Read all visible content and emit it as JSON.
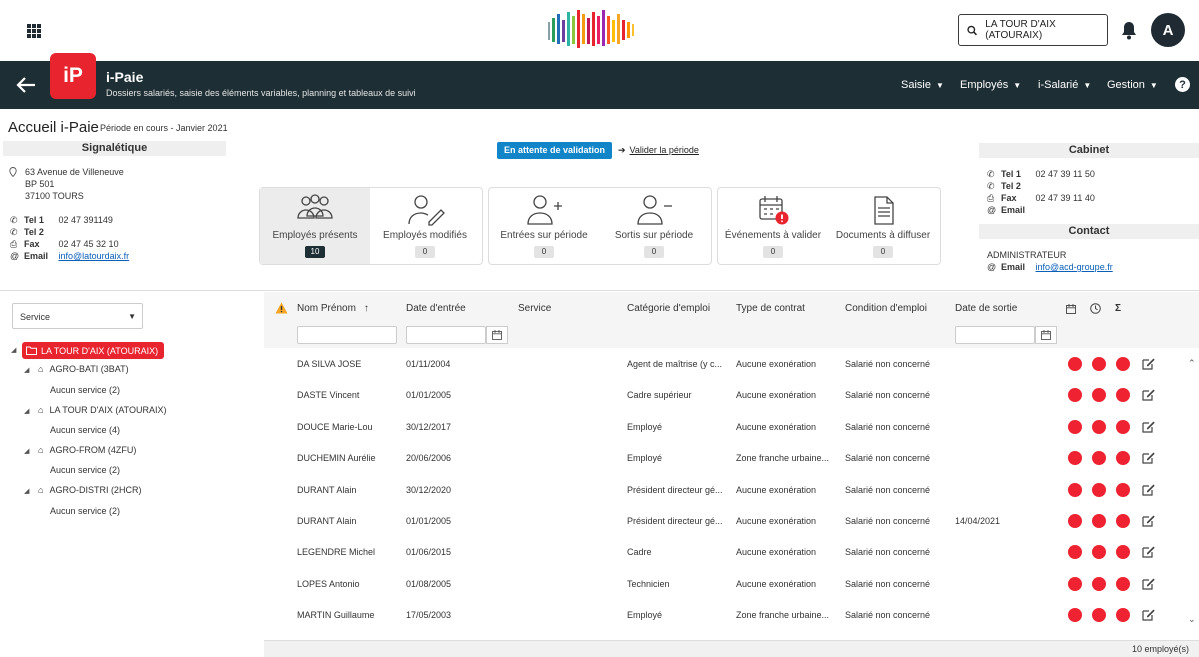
{
  "top": {
    "search_label": "LA TOUR D'AIX (ATOURAIX)",
    "avatar_initial": "A"
  },
  "app": {
    "logo_text": "iP",
    "title": "i-Paie",
    "subtitle": "Dossiers salariés, saisie des éléments variables, planning et tableaux de suivi",
    "nav": [
      "Saisie",
      "Employés",
      "i-Salarié",
      "Gestion"
    ],
    "help": "?"
  },
  "page": {
    "title": "Accueil i-Paie",
    "period": "Période en cours - Janvier 2021"
  },
  "signaletique": {
    "heading": "Signalétique",
    "address": [
      "63 Avenue de Villeneuve",
      "BP 501",
      "37100 TOURS"
    ],
    "tel1_label": "Tel 1",
    "tel1": "02 47 391149",
    "tel2_label": "Tel 2",
    "fax_label": "Fax",
    "fax": "02 47 45 32 10",
    "email_label": "Email",
    "email": "info@latourdaix.fr"
  },
  "status": {
    "pill": "En attente de validation",
    "validate_link": "Valider la période"
  },
  "kpis": [
    {
      "label": "Employés présents",
      "count": "10"
    },
    {
      "label": "Employés modifiés",
      "count": "0"
    },
    {
      "label": "Entrées sur période",
      "count": "0"
    },
    {
      "label": "Sortis sur période",
      "count": "0"
    },
    {
      "label": "Événements à valider",
      "count": "0"
    },
    {
      "label": "Documents à diffuser",
      "count": "0"
    }
  ],
  "cabinet": {
    "heading": "Cabinet",
    "tel1_label": "Tel 1",
    "tel1": "02 47 39 11 50",
    "tel2_label": "Tel 2",
    "fax_label": "Fax",
    "fax": "02 47 39 11 40",
    "email_label": "Email"
  },
  "contact": {
    "heading": "Contact",
    "name": "ADMINISTRATEUR",
    "email_label": "Email",
    "email": "info@acd-groupe.fr"
  },
  "sidebar": {
    "select_value": "Service",
    "root": "LA TOUR D'AIX (ATOURAIX)",
    "nodes": [
      {
        "label": "AGRO-BATI (3BAT)",
        "child": "Aucun service (2)"
      },
      {
        "label": "LA TOUR D'AIX (ATOURAIX)",
        "child": "Aucun service (4)"
      },
      {
        "label": "AGRO-FROM (4ZFU)",
        "child": "Aucun service (2)"
      },
      {
        "label": "AGRO-DISTRI (2HCR)",
        "child": "Aucun service (2)"
      }
    ]
  },
  "table": {
    "columns": [
      "Nom Prénom",
      "Date d'entrée",
      "Service",
      "Catégorie d'emploi",
      "Type de contrat",
      "Condition d'emploi",
      "Date de sortie"
    ],
    "sort_indicator": "↑",
    "sigma": "Σ",
    "rows": [
      [
        "DA SILVA JOSE",
        "01/11/2004",
        "",
        "Agent de maîtrise (y c...",
        "Aucune exonération",
        "Salarié non concerné",
        ""
      ],
      [
        "DASTE Vincent",
        "01/01/2005",
        "",
        "Cadre supérieur",
        "Aucune exonération",
        "Salarié non concerné",
        ""
      ],
      [
        "DOUCE Marie-Lou",
        "30/12/2017",
        "",
        "Employé",
        "Aucune exonération",
        "Salarié non concerné",
        ""
      ],
      [
        "DUCHEMIN Aurélie",
        "20/06/2006",
        "",
        "Employé",
        "Zone franche urbaine...",
        "Salarié non concerné",
        ""
      ],
      [
        "DURANT Alain",
        "30/12/2020",
        "",
        "Président directeur gé...",
        "Aucune exonération",
        "Salarié non concerné",
        ""
      ],
      [
        "DURANT Alain",
        "01/01/2005",
        "",
        "Président directeur gé...",
        "Aucune exonération",
        "Salarié non concerné",
        "14/04/2021"
      ],
      [
        "LEGENDRE Michel",
        "01/06/2015",
        "",
        "Cadre",
        "Aucune exonération",
        "Salarié non concerné",
        ""
      ],
      [
        "LOPES Antonio",
        "01/08/2005",
        "",
        "Technicien",
        "Aucune exonération",
        "Salarié non concerné",
        ""
      ],
      [
        "MARTIN Guillaume",
        "17/05/2003",
        "",
        "Employé",
        "Zone franche urbaine...",
        "Salarié non concerné",
        ""
      ]
    ],
    "footer_count": "10 employé(s)"
  },
  "colors": {
    "band": "#1d2e34",
    "brand_red": "#e8242f",
    "status_blue": "#1185c8",
    "dot_red": "#ee2230"
  }
}
